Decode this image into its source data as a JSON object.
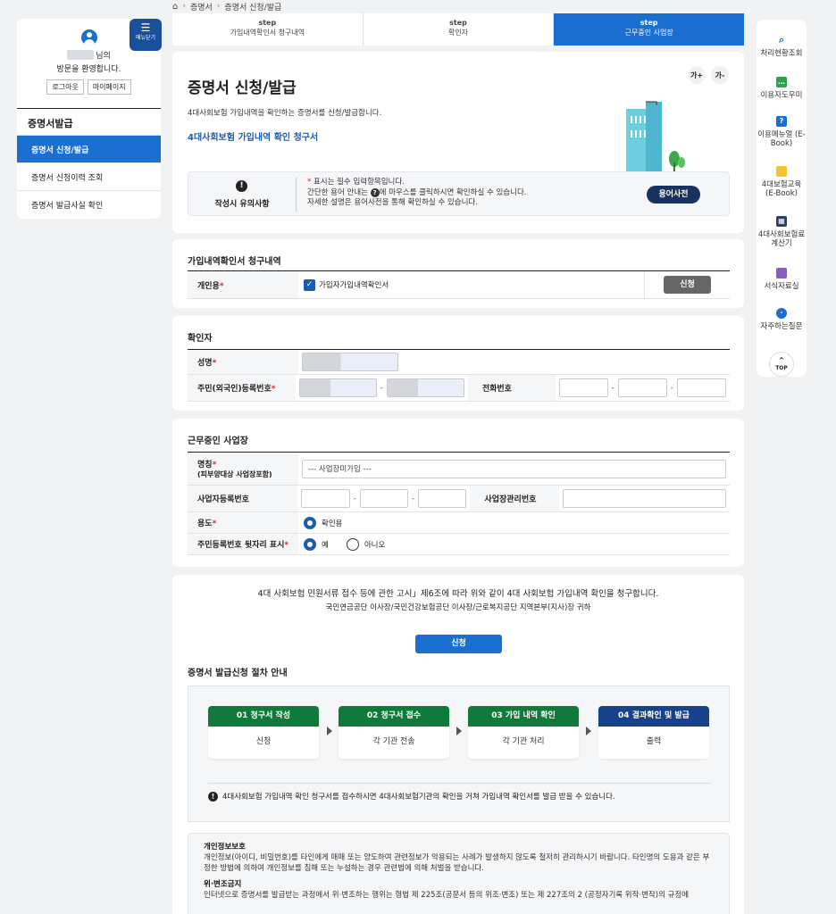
{
  "breadcrumb": [
    "증명서",
    "증명서 신청/발급"
  ],
  "sidebar": {
    "menu_label": "메뉴닫기",
    "user_suffix": "님의",
    "welcome": "방문을 환영합니다.",
    "logout": "로그아웃",
    "mypage": "마이페이지",
    "section_title": "증명서발급",
    "items": [
      {
        "label": "증명서 신청/발급",
        "active": true
      },
      {
        "label": "증명서 신청이력 조회",
        "active": false
      },
      {
        "label": "증명서 발급사실 확인",
        "active": false
      }
    ]
  },
  "top_steps": [
    {
      "small": "step",
      "label": "가입내역확인서 청구내역"
    },
    {
      "small": "step",
      "label": "확인자"
    },
    {
      "small": "step",
      "label": "근무중인 사업장"
    }
  ],
  "header": {
    "title": "증명서 신청/발급",
    "desc": "4대사회보험 가입내역을 확인하는 증명서를 신청/발급합니다.",
    "link": "4대사회보험 가입내역 확인 청구서",
    "font_up": "가+",
    "font_down": "가-",
    "notice_label": "작성시 유의사항",
    "notice_line1": "표시는 필수 입력항목입니다.",
    "notice_line2a": "간단한 용어 안내는",
    "notice_line2b": "에 마우스를 클릭하시면 확인하실 수 있습니다.",
    "notice_line3": "자세한 설명은 용어사전을 통해 확인하실 수 있습니다.",
    "dict_button": "용어사전"
  },
  "claim": {
    "title": "가입내역확인서 청구내역",
    "row_label": "개인용",
    "checkbox_label": "가입자가입내역확인서",
    "apply": "신청"
  },
  "confirmer": {
    "title": "확인자",
    "name_label": "성명",
    "rrn_label": "주민(외국인)등록번호",
    "phone_label": "전화번호"
  },
  "workplace": {
    "title": "근무중인 사업장",
    "name_label": "명칭",
    "name_sub": "(피부양대상 사업장포함)",
    "name_value": "--- 사업장미가입 ---",
    "bizno_label": "사업자등록번호",
    "mgmt_label": "사업장관리번호",
    "purpose_label": "용도",
    "purpose_option": "확인용",
    "rrn_tail_label": "주민등록번호 뒷자리 표시",
    "yes": "예",
    "no": "아니오"
  },
  "bottom": {
    "statement": "4대 사회보험 민원서류 접수 등에 관한 고시」제6조에 따라 위와 같이 4대 사회보험 가입내역 확인을 청구합니다.",
    "addressee": "국민연금공단 이사장/국민건강보험공단 이사장/근로복지공단 지역본부(지사)장 귀하",
    "submit": "신청",
    "process_title": "증명서 발급신청 절차 안내",
    "process": [
      {
        "head": "01 청구서 작성",
        "body": "신청"
      },
      {
        "head": "02 청구서 접수",
        "body": "각 기관 전송"
      },
      {
        "head": "03 가입 내역 확인",
        "body": "각 기관 처리"
      },
      {
        "head": "04 결과확인 및 발급",
        "body": "출력"
      }
    ],
    "process_note": "4대사회보험 가입내역 확인 청구서를 접수하시면 4대사회보험기관의 확인을 거쳐 가입내역 확인서를 발급 받을 수 있습니다.",
    "privacy_title": "개인정보보호",
    "privacy_text": "개인정보(아이디, 비밀번호)를 타인에게 매매 또는 양도하여 관련정보가 악용되는 사례가 발생하지 않도록 철저히 관리하시기 바랍니다. 타인명의 도용과 같은 부정한 방법에 의하여 개인정보를 침해 또는 누설하는 경우 관련법에 의해 처벌을 받습니다.",
    "forgery_title": "위·변조금지",
    "forgery_text": "인터넷으로 증명서를 발급받는 과정에서 위·변조하는 행위는 형법 제 225조(공문서 등의 위조·변조) 또는 제 227조의 2 (공정자기록 위작·변작)의 규정에"
  },
  "quick_menu": [
    {
      "label": "처리현황조회",
      "icon": "search-icon",
      "color": "#1a6fd0"
    },
    {
      "label": "이용자도우미",
      "icon": "chat-icon",
      "color": "#2aa34a"
    },
    {
      "label": "이용메뉴얼 (E-Book)",
      "icon": "help-icon",
      "color": "#1a6fd0"
    },
    {
      "label": "4대보험교육 (E-Book)",
      "icon": "folder-icon",
      "color": "#f2c230"
    },
    {
      "label": "4대사회보험료 계산기",
      "icon": "calculator-icon",
      "color": "#2a3f6a"
    },
    {
      "label": "서식자료실",
      "icon": "folder-icon",
      "color": "#8a5cc0"
    },
    {
      "label": "자주하는질문",
      "icon": "faq-icon",
      "color": "#1a6fd0"
    }
  ],
  "top_button": "TOP"
}
